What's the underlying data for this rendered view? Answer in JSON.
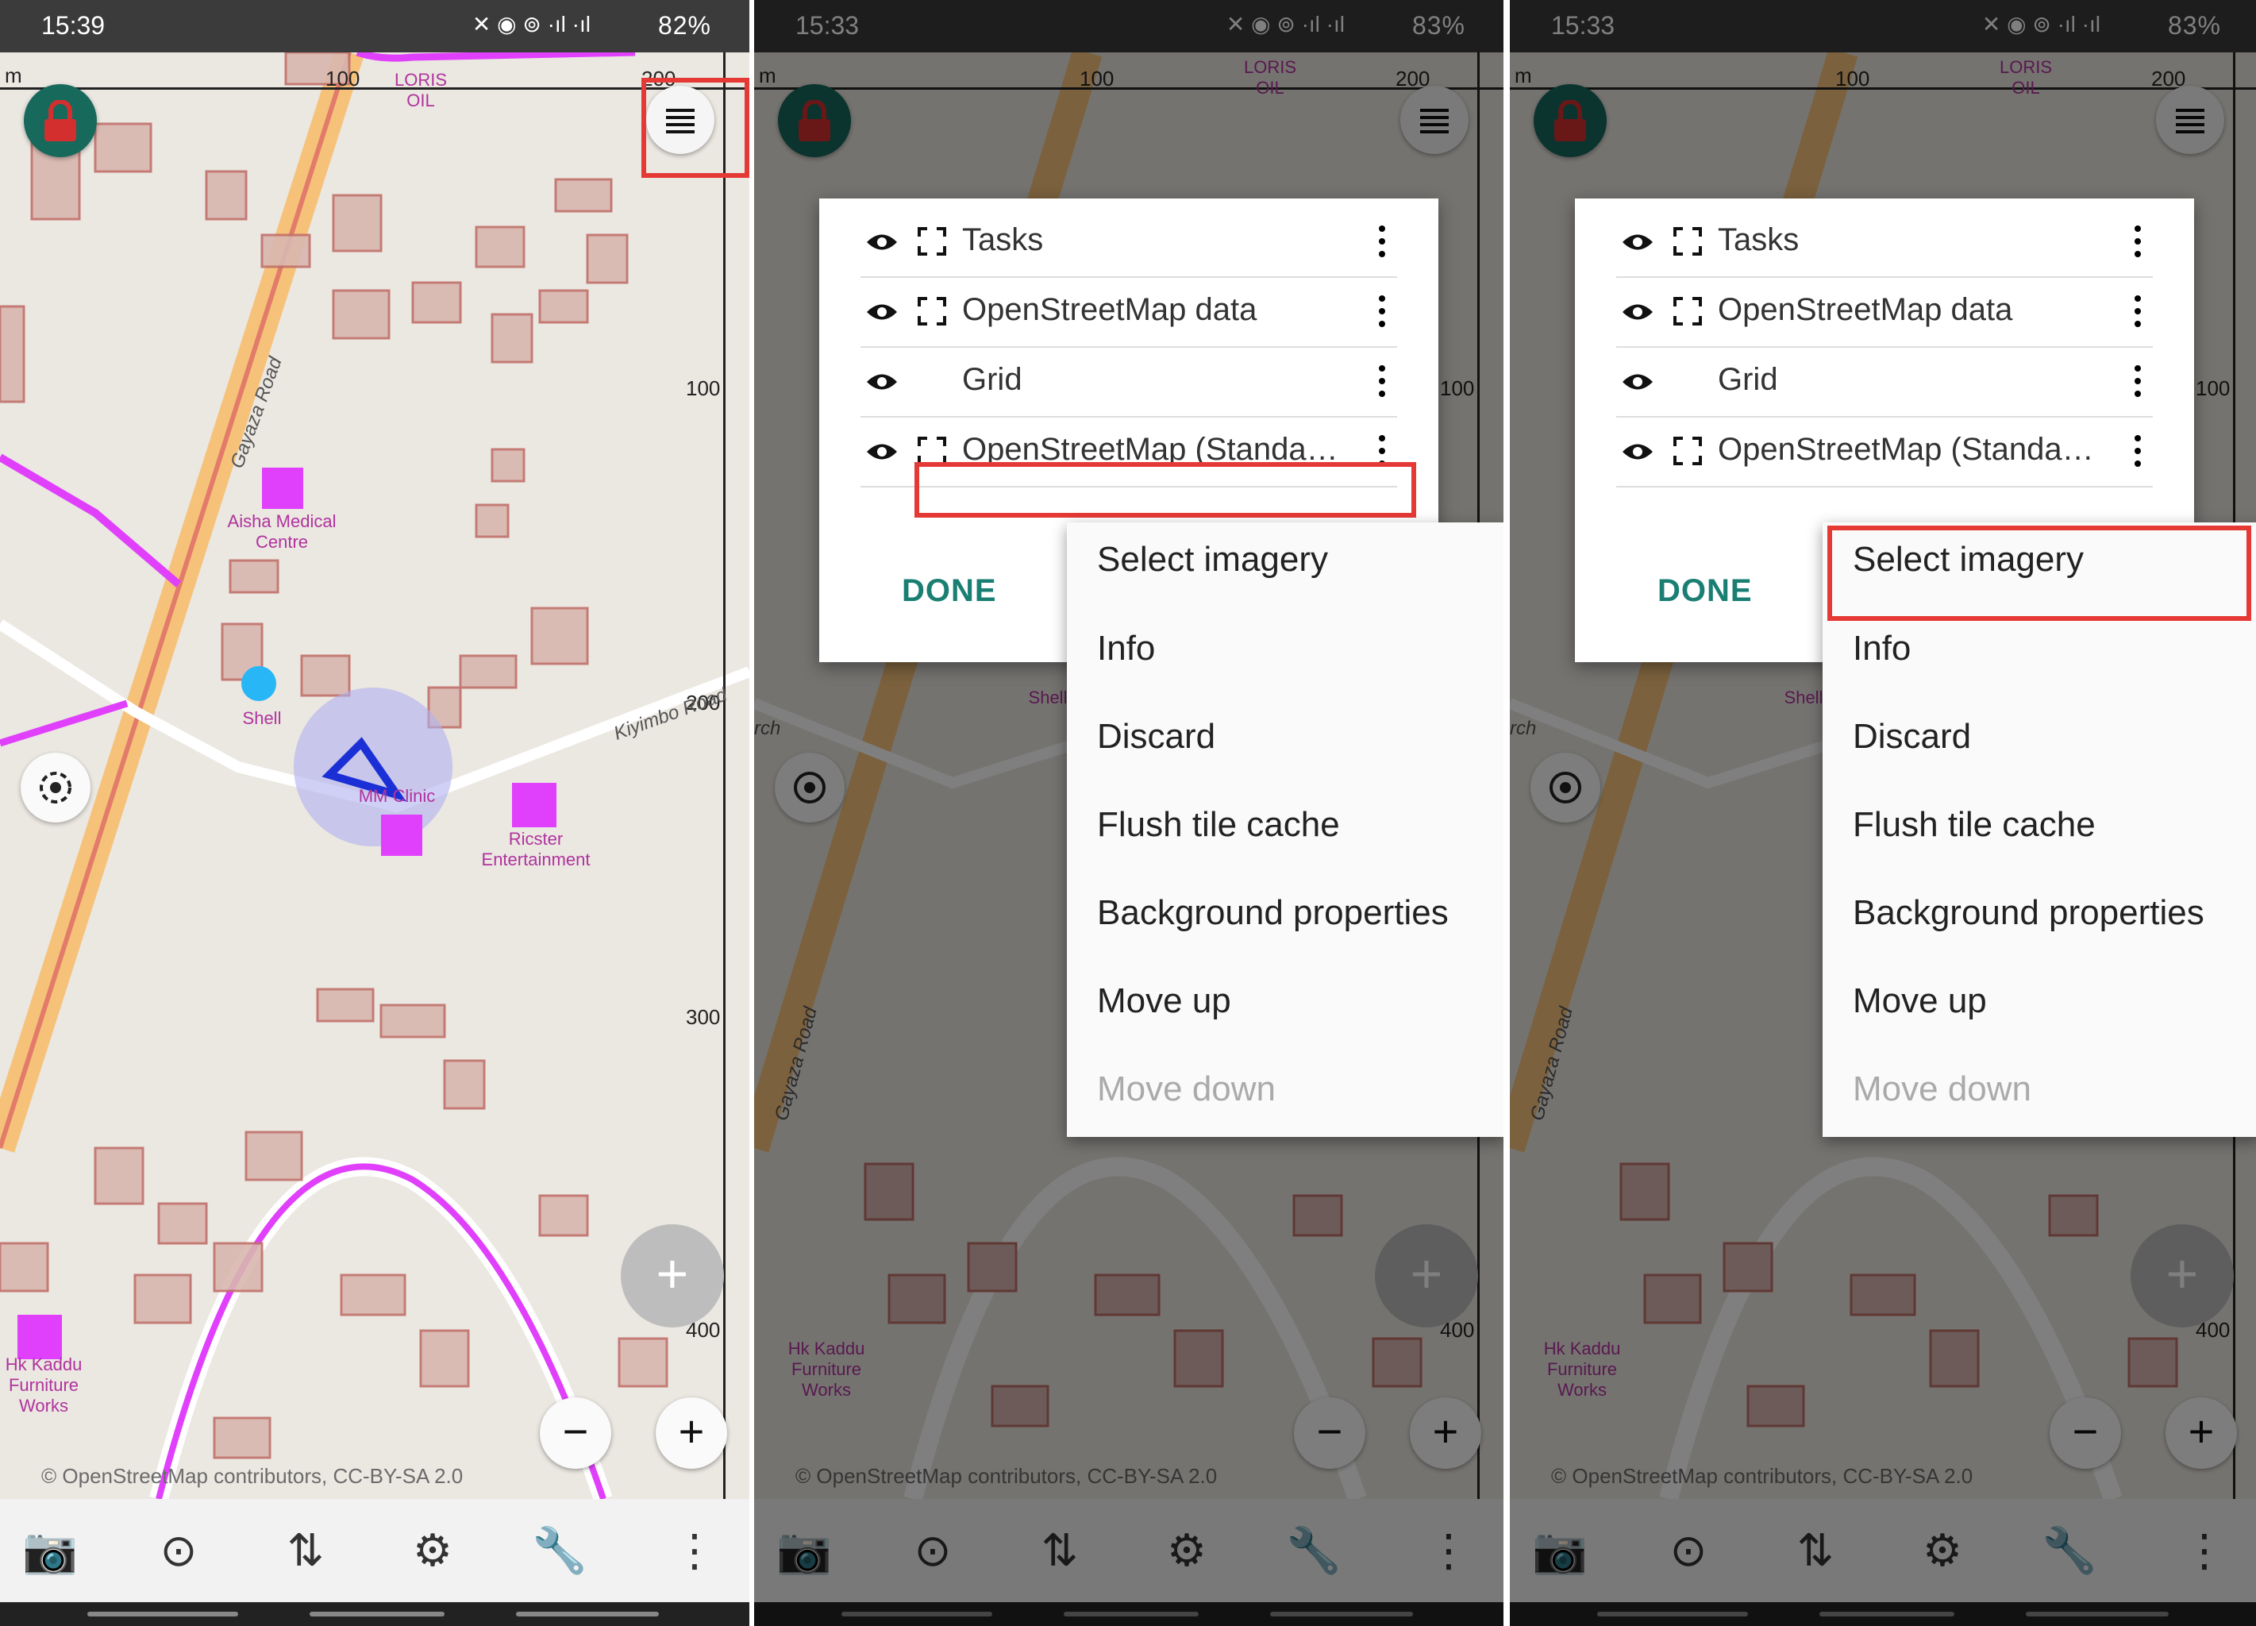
{
  "panels": [
    {
      "status": {
        "time": "15:39",
        "battery": "82%"
      },
      "map": {
        "ruler_top": [
          "m",
          "100",
          "200"
        ],
        "ruler_right": [
          "100",
          "200",
          "300",
          "400"
        ],
        "pois": [
          "Aisha Medical Centre",
          "Shell",
          "MM Clinic",
          "Ricster Entertainment",
          "Hk Kaddu Furniture Works",
          "LORIS OIL"
        ],
        "road_labels": [
          "Gayaza Road",
          "Kiyimbo Road"
        ],
        "attribution": "© OpenStreetMap contributors, CC-BY-SA 2.0"
      },
      "controls": {
        "fab": "+",
        "zoom_out": "−",
        "zoom_in": "+"
      },
      "bottom_bar": [
        "camera-icon",
        "gps-icon",
        "transfer-icon",
        "settings-icon",
        "wrench-icon",
        "more-icon"
      ]
    },
    {
      "status": {
        "time": "15:33",
        "battery": "83%"
      },
      "map": {
        "ruler_top": [
          "m",
          "100",
          "200"
        ],
        "ruler_right": [
          "100",
          "400"
        ],
        "pois": [
          "Hk Kaddu Furniture Works",
          "LORIS OIL",
          "Shell"
        ],
        "road_labels": [
          "Gayaza Road",
          "rch"
        ],
        "attribution": "© OpenStreetMap contributors, CC-BY-SA 2.0"
      },
      "controls": {
        "fab": "+",
        "zoom_out": "−",
        "zoom_in": "+"
      },
      "layers": [
        "Tasks",
        "OpenStreetMap data",
        "Grid",
        "OpenStreetMap (Standa…"
      ],
      "done_label": "DONE",
      "menu": [
        "Select imagery",
        "Info",
        "Discard",
        "Flush tile cache",
        "Background properties",
        "Move up",
        "Move down"
      ]
    },
    {
      "status": {
        "time": "15:33",
        "battery": "83%"
      },
      "map": {
        "ruler_top": [
          "m",
          "100",
          "200"
        ],
        "ruler_right": [
          "100",
          "400"
        ],
        "pois": [
          "Hk Kaddu Furniture Works",
          "LORIS OIL",
          "Shell"
        ],
        "road_labels": [
          "Gayaza Road",
          "rch"
        ],
        "attribution": "© OpenStreetMap contributors, CC-BY-SA 2.0"
      },
      "controls": {
        "fab": "+",
        "zoom_out": "−",
        "zoom_in": "+"
      },
      "layers": [
        "Tasks",
        "OpenStreetMap data",
        "Grid",
        "OpenStreetMap (Standa…"
      ],
      "done_label": "DONE",
      "menu": [
        "Select imagery",
        "Info",
        "Discard",
        "Flush tile cache",
        "Background properties",
        "Move up",
        "Move down"
      ]
    }
  ],
  "colors": {
    "highlight": "#e53935",
    "lock_button": "#17695c",
    "done": "#1a7f72",
    "road_main": "#f6c27a",
    "road_path": "#e040fb",
    "building": "#d9b7b0"
  }
}
